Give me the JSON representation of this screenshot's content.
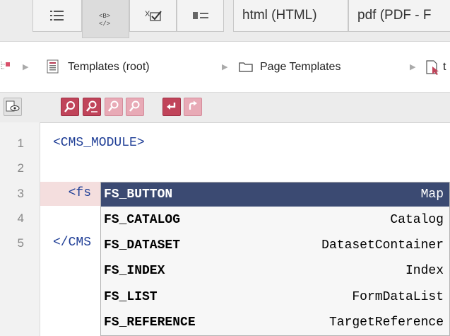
{
  "tabs": [
    {
      "icon": "list-view-icon",
      "active": false
    },
    {
      "icon": "code-braces-icon",
      "active": true
    },
    {
      "icon": "checkbox-check-icon",
      "active": false
    },
    {
      "icon": "form-fields-icon",
      "active": false
    },
    {
      "label": "html (HTML)",
      "active": false
    },
    {
      "label": "pdf (PDF - F",
      "active": false
    }
  ],
  "breadcrumb": {
    "root_icon": "tree-root-icon",
    "items": [
      {
        "icon": "templates-folder-icon",
        "label": "Templates (root)"
      },
      {
        "icon": "folder-icon",
        "label": "Page Templates"
      },
      {
        "icon": "page-template-icon",
        "label": "t"
      }
    ]
  },
  "toolbar": {
    "buttons": [
      {
        "icon": "preview-eye-icon",
        "enabled": true
      },
      {
        "icon": "search-icon",
        "enabled": true
      },
      {
        "icon": "search-replace-icon",
        "enabled": true
      },
      {
        "icon": "search-prev-icon",
        "enabled": false
      },
      {
        "icon": "search-next-icon",
        "enabled": false
      },
      {
        "icon": "undo-icon",
        "enabled": true
      },
      {
        "icon": "redo-icon",
        "enabled": false
      }
    ]
  },
  "editor": {
    "lines": [
      {
        "number": "1",
        "text": "<CMS_MODULE>"
      },
      {
        "number": "2",
        "text": ""
      },
      {
        "number": "3",
        "text": "  <fs"
      },
      {
        "number": "4",
        "text": ""
      },
      {
        "number": "5",
        "text": "</CMS"
      }
    ],
    "active_line": "3"
  },
  "autocomplete": {
    "items": [
      {
        "name": "FS_BUTTON",
        "type": "Map",
        "selected": true
      },
      {
        "name": "FS_CATALOG",
        "type": "Catalog",
        "selected": false
      },
      {
        "name": "FS_DATASET",
        "type": "DatasetContainer",
        "selected": false
      },
      {
        "name": "FS_INDEX",
        "type": "Index",
        "selected": false
      },
      {
        "name": "FS_LIST",
        "type": "FormDataList",
        "selected": false
      },
      {
        "name": "FS_REFERENCE",
        "type": "TargetReference",
        "selected": false
      }
    ]
  },
  "colors": {
    "accent_red": "#c0445a",
    "selection": "#3b4a72",
    "tag_blue": "#1f3e96",
    "active_line": "#f4dede"
  }
}
